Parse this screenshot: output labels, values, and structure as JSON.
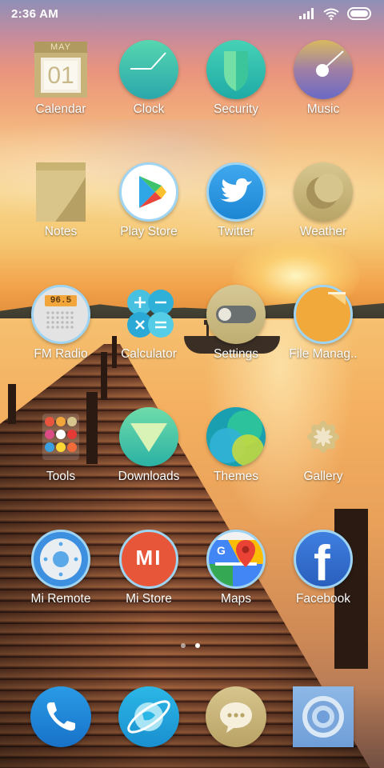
{
  "status_bar": {
    "time": "2:36 AM"
  },
  "home_apps": [
    {
      "label": "Calendar",
      "icon": "calendar-icon",
      "icon_text_month": "MAY",
      "icon_text_day": "01"
    },
    {
      "label": "Clock",
      "icon": "clock-icon"
    },
    {
      "label": "Security",
      "icon": "shield-icon"
    },
    {
      "label": "Music",
      "icon": "music-icon"
    },
    {
      "label": "Notes",
      "icon": "notes-icon"
    },
    {
      "label": "Play Store",
      "icon": "play-store-icon"
    },
    {
      "label": "Twitter",
      "icon": "twitter-bird-icon"
    },
    {
      "label": "Weather",
      "icon": "weather-moon-icon"
    },
    {
      "label": "FM Radio",
      "icon": "radio-icon",
      "icon_text": "96.5"
    },
    {
      "label": "Calculator",
      "icon": "calculator-icon"
    },
    {
      "label": "Settings",
      "icon": "toggle-settings-icon"
    },
    {
      "label": "File Manag..",
      "icon": "folder-icon"
    },
    {
      "label": "Tools",
      "icon": "tools-folder-icon"
    },
    {
      "label": "Downloads",
      "icon": "download-arrow-icon"
    },
    {
      "label": "Themes",
      "icon": "themes-icon"
    },
    {
      "label": "Gallery",
      "icon": "gallery-flower-icon"
    },
    {
      "label": "Mi Remote",
      "icon": "remote-icon"
    },
    {
      "label": "Mi Store",
      "icon": "mi-logo-icon",
      "icon_text": "MI"
    },
    {
      "label": "Maps",
      "icon": "maps-pin-icon"
    },
    {
      "label": "Facebook",
      "icon": "facebook-f-icon",
      "icon_text": "f"
    }
  ],
  "page_indicator": {
    "pages": 2,
    "current": 2
  },
  "dock": [
    {
      "icon": "phone-icon"
    },
    {
      "icon": "browser-icon"
    },
    {
      "icon": "messages-icon"
    },
    {
      "icon": "camera-icon"
    }
  ],
  "colors": {
    "teal": "#2fb5b0",
    "blue": "#1e8fdc",
    "gold": "#c9b57a"
  }
}
